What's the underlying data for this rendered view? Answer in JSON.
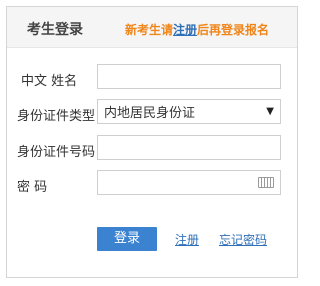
{
  "header": {
    "title": "考生登录",
    "hint_prefix": "新考生请",
    "hint_link": "注册",
    "hint_suffix": "后再登录报名"
  },
  "form": {
    "name_label": "中文  姓名",
    "id_type_label": "身份证件类型",
    "id_type_value": "内地居民身份证",
    "id_number_label": "身份证件号码",
    "password_label": "密        码"
  },
  "actions": {
    "login_label": "登录",
    "register_label": "注册",
    "forgot_label": "忘记密码"
  },
  "icons": {
    "select_arrow": "chevron-down-icon",
    "keyboard": "keyboard-icon"
  },
  "colors": {
    "accent": "#3b82d0",
    "hint": "#f08519",
    "link": "#2f6fb8"
  }
}
